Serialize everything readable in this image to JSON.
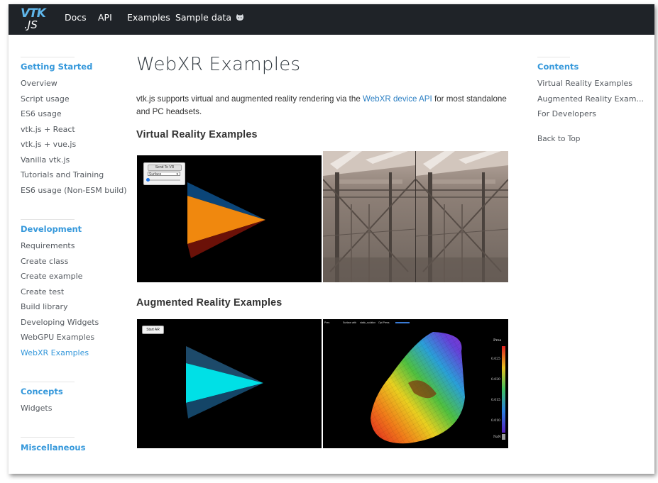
{
  "topnav": {
    "logo_top": "VTK",
    "logo_bottom": ".JS",
    "links": [
      "Docs",
      "API",
      "Examples",
      "Sample data"
    ],
    "icon": "github-icon"
  },
  "sidebar": {
    "sections": [
      {
        "heading": "Getting Started",
        "items": [
          "Overview",
          "Script usage",
          "ES6 usage",
          "vtk.js + React",
          "vtk.js + vue.js",
          "Vanilla vtk.js",
          "Tutorials and Training",
          "ES6 usage (Non-ESM build)"
        ]
      },
      {
        "heading": "Development",
        "items": [
          "Requirements",
          "Create class",
          "Create example",
          "Create test",
          "Build library",
          "Developing Widgets",
          "WebGPU Examples",
          "WebXR Examples"
        ]
      },
      {
        "heading": "Concepts",
        "items": [
          "Widgets"
        ]
      },
      {
        "heading": "Miscellaneous",
        "items": []
      }
    ],
    "active_item": "WebXR Examples"
  },
  "main": {
    "title": "WebXR Examples",
    "intro_before": "vtk.js supports virtual and augmented reality rendering via the ",
    "intro_link": "WebXR device API",
    "intro_after": " for most standalone and PC headsets.",
    "vr_heading": "Virtual Reality Examples",
    "ar_heading": "Augmented Reality Examples",
    "vr_panel": {
      "button": "Send To VR",
      "select": "Surface",
      "slider_value": 0
    },
    "ar_panel": {
      "button": "Start AR"
    },
    "ar_viz": {
      "toolbar": [
        "Pres",
        "Surface with",
        "static_solution",
        "Opt Press"
      ],
      "colorbar_title": "Pres",
      "colorbar_ticks": [
        "0.025",
        "0.020",
        "0.015",
        "0.010",
        "NaN"
      ]
    }
  },
  "toc": {
    "heading": "Contents",
    "items": [
      "Virtual Reality Examples",
      "Augmented Reality Exam...",
      "For Developers"
    ],
    "back": "Back to Top"
  },
  "colors": {
    "accent": "#3598db",
    "link": "#2b7fc3",
    "topbar": "#1f2328"
  }
}
